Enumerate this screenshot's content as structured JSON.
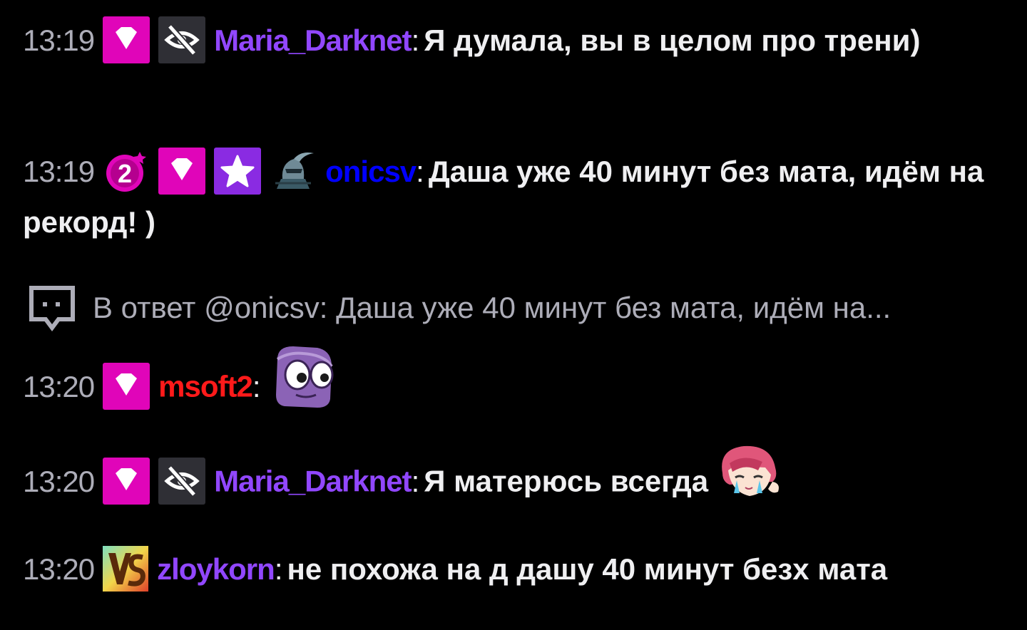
{
  "messages": [
    {
      "time": "13:19",
      "badges": [
        "prime-gem-badge",
        "no-eye-badge"
      ],
      "username": "Maria_Darknet",
      "username_color": "#9147ff",
      "text": "Я думала, вы в целом про трени)"
    },
    {
      "time": "13:19",
      "badges": [
        "sub-gift-badge",
        "prime-gem-badge",
        "star-badge",
        "knight-avatar-badge"
      ],
      "sub_gift_count": "2",
      "username": "onicsv",
      "username_color": "#0000ff",
      "text": "Даша уже 40 минут без мата, идём на рекорд! )"
    },
    {
      "reply_prefix": "В ответ",
      "reply_to": "@onicsv:",
      "reply_text": "Даша уже 40 минут без мата, идём на...",
      "time": "13:20",
      "badges": [
        "prime-gem-badge"
      ],
      "username": "msoft2",
      "username_color": "#ff1a1a",
      "text": "",
      "emote": "purple-face-emote"
    },
    {
      "time": "13:20",
      "badges": [
        "prime-gem-badge",
        "no-eye-badge"
      ],
      "username": "Maria_Darknet",
      "username_color": "#9147ff",
      "text": "Я матерюсь всегда",
      "emote": "crying-pink-hair-emote"
    },
    {
      "time": "13:20",
      "badges": [
        "vs-badge"
      ],
      "username": "zloykorn",
      "username_color": "#9147ff",
      "text": "не похожа на д дашу 40 минут безх мата"
    }
  ],
  "colors": {
    "background": "#000000",
    "timestamp": "#adadb8",
    "text": "#efeff1",
    "gem_badge": "#e005b9",
    "star_badge": "#8a2be2",
    "muted_badge": "#2f2f35"
  }
}
